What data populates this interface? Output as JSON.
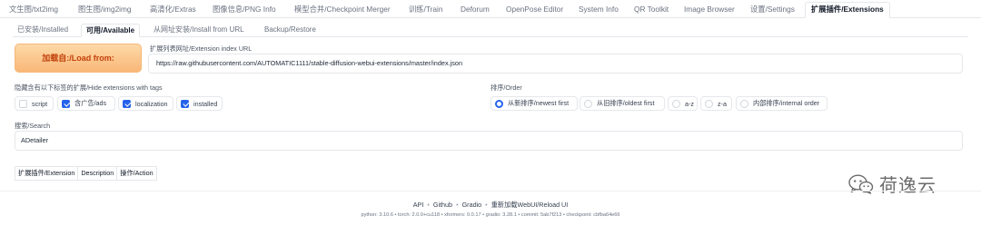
{
  "top_tabs": [
    {
      "label": "文生图/txt2img"
    },
    {
      "label": "图生图/img2img"
    },
    {
      "label": "高清化/Extras"
    },
    {
      "label": "图像信息/PNG Info"
    },
    {
      "label": "模型合并/Checkpoint Merger"
    },
    {
      "label": "训练/Train"
    },
    {
      "label": "Deforum"
    },
    {
      "label": "OpenPose Editor"
    },
    {
      "label": "System Info"
    },
    {
      "label": "QR Toolkit"
    },
    {
      "label": "Image Browser"
    },
    {
      "label": "设置/Settings"
    },
    {
      "label": "扩展插件/Extensions",
      "active": true
    }
  ],
  "sub_tabs": [
    {
      "label": "已安装/Installed"
    },
    {
      "label": "可用/Available",
      "active": true
    },
    {
      "label": "从网址安装/Install from URL"
    },
    {
      "label": "Backup/Restore"
    }
  ],
  "load_button": "加载自:/Load from:",
  "index_url": {
    "label": "扩展列表网址/Extension index URL",
    "value": "https://raw.githubusercontent.com/AUTOMATIC1111/stable-diffusion-webui-extensions/master/index.json"
  },
  "hide_tags": {
    "label": "隐藏含有以下标签的扩展/Hide extensions with tags",
    "options": [
      {
        "label": "script",
        "checked": false
      },
      {
        "label": "含广告/ads",
        "checked": true
      },
      {
        "label": "localization",
        "checked": true
      },
      {
        "label": "installed",
        "checked": true
      }
    ]
  },
  "order": {
    "label": "排序/Order",
    "options": [
      {
        "label": "从新排序/newest first",
        "selected": true
      },
      {
        "label": "从旧排序/oldest first",
        "selected": false
      },
      {
        "label": "a-z",
        "selected": false
      },
      {
        "label": "z-a",
        "selected": false
      },
      {
        "label": "内部排序/internal order",
        "selected": false
      }
    ]
  },
  "search": {
    "label": "搜索/Search",
    "value": "ADetailer"
  },
  "table_headers": [
    "扩展插件/Extension",
    "Description",
    "操作/Action"
  ],
  "footer": {
    "links": [
      "API",
      "Github",
      "Gradio",
      "重新加载WebUI/Reload UI"
    ],
    "separator": "•",
    "version": "python: 3.10.6  •  torch: 2.0.0+cu118  •  xformers: 0.0.17  •  gradio: 3.28.1  •  commit: 5ab7f213  •  checkpoint: cbfba64e66"
  },
  "watermark": {
    "text": "荷逸云",
    "icon": "wechat-icon"
  },
  "colors": {
    "accent": "#2563eb",
    "load_button_bg": "#f9b777",
    "load_button_text": "#c2410c"
  }
}
